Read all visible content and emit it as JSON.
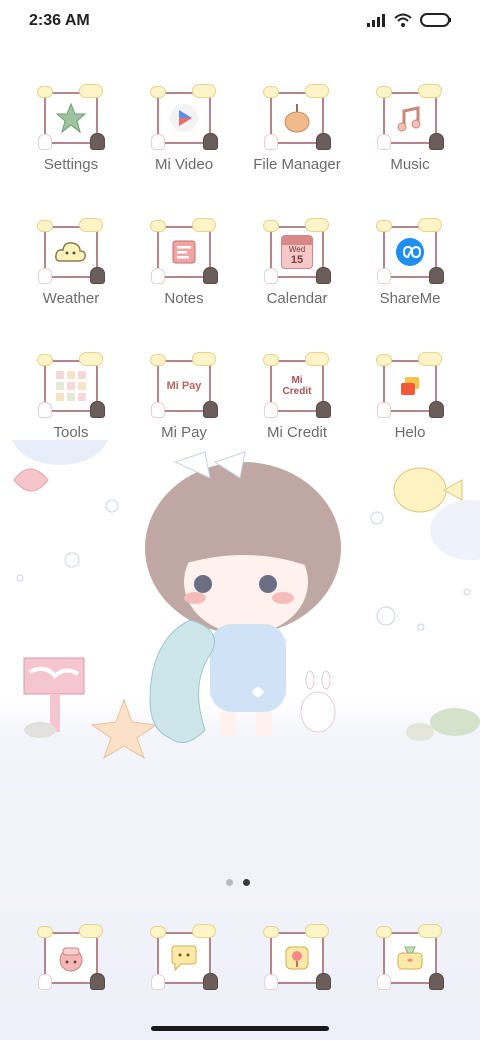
{
  "status_bar": {
    "time": "2:36 AM"
  },
  "apps": [
    {
      "label": "Settings",
      "icon": "starfish-icon"
    },
    {
      "label": "Mi Video",
      "icon": "play-icon"
    },
    {
      "label": "File Manager",
      "icon": "fruit-icon"
    },
    {
      "label": "Music",
      "icon": "music-note-icon"
    },
    {
      "label": "Weather",
      "icon": "cloud-icon"
    },
    {
      "label": "Notes",
      "icon": "notes-icon"
    },
    {
      "label": "Calendar",
      "icon": "calendar-icon",
      "day": "Wed",
      "date": "15"
    },
    {
      "label": "ShareMe",
      "icon": "shareme-icon"
    },
    {
      "label": "Tools",
      "icon": "tools-folder-icon"
    },
    {
      "label": "Mi Pay",
      "icon": "mipay-icon",
      "text": "Mi Pay"
    },
    {
      "label": "Mi Credit",
      "icon": "micredit-icon",
      "text": "Mi Credit"
    },
    {
      "label": "Helo",
      "icon": "helo-icon"
    }
  ],
  "dock": [
    {
      "icon": "phone-icon"
    },
    {
      "icon": "messages-icon"
    },
    {
      "icon": "browser-icon"
    },
    {
      "icon": "camera-icon"
    }
  ],
  "pager": {
    "pages": 2,
    "active": 2
  },
  "colors": {
    "frame": "#b5848c",
    "label": "#6b6b6b",
    "bubble": "#d7e2f5"
  }
}
